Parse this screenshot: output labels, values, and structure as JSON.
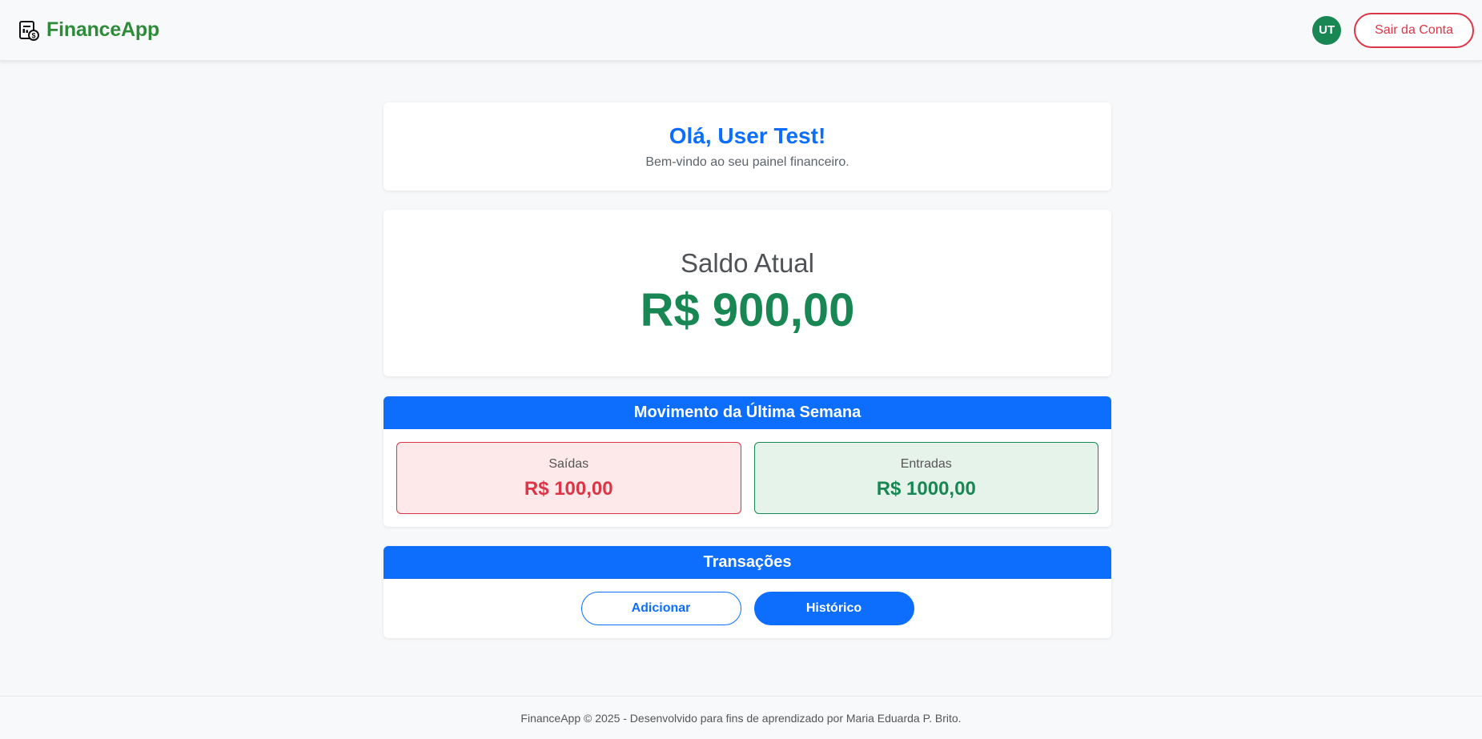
{
  "header": {
    "brand": "FinanceApp",
    "brand_icon": "finance-document-icon",
    "avatar_initials": "UT",
    "logout_label": "Sair da Conta",
    "colors": {
      "brand": "#2e8b3a",
      "avatar": "#198754",
      "logout": "#dc3545"
    }
  },
  "welcome": {
    "title": "Olá, User Test!",
    "subtitle": "Bem-vindo ao seu painel financeiro."
  },
  "balance": {
    "label": "Saldo Atual",
    "amount": "R$ 900,00"
  },
  "movement": {
    "title": "Movimento da Última Semana",
    "outflows": {
      "label": "Saídas",
      "value": "R$ 100,00"
    },
    "inflows": {
      "label": "Entradas",
      "value": "R$ 1000,00"
    }
  },
  "transactions": {
    "title": "Transações",
    "add_label": "Adicionar",
    "history_label": "Histórico"
  },
  "footer": {
    "text": "FinanceApp © 2025 - Desenvolvido para fins de aprendizado por Maria Eduarda P. Brito."
  },
  "colors": {
    "primary": "#0d6efd",
    "success": "#198754",
    "danger": "#dc3545"
  }
}
